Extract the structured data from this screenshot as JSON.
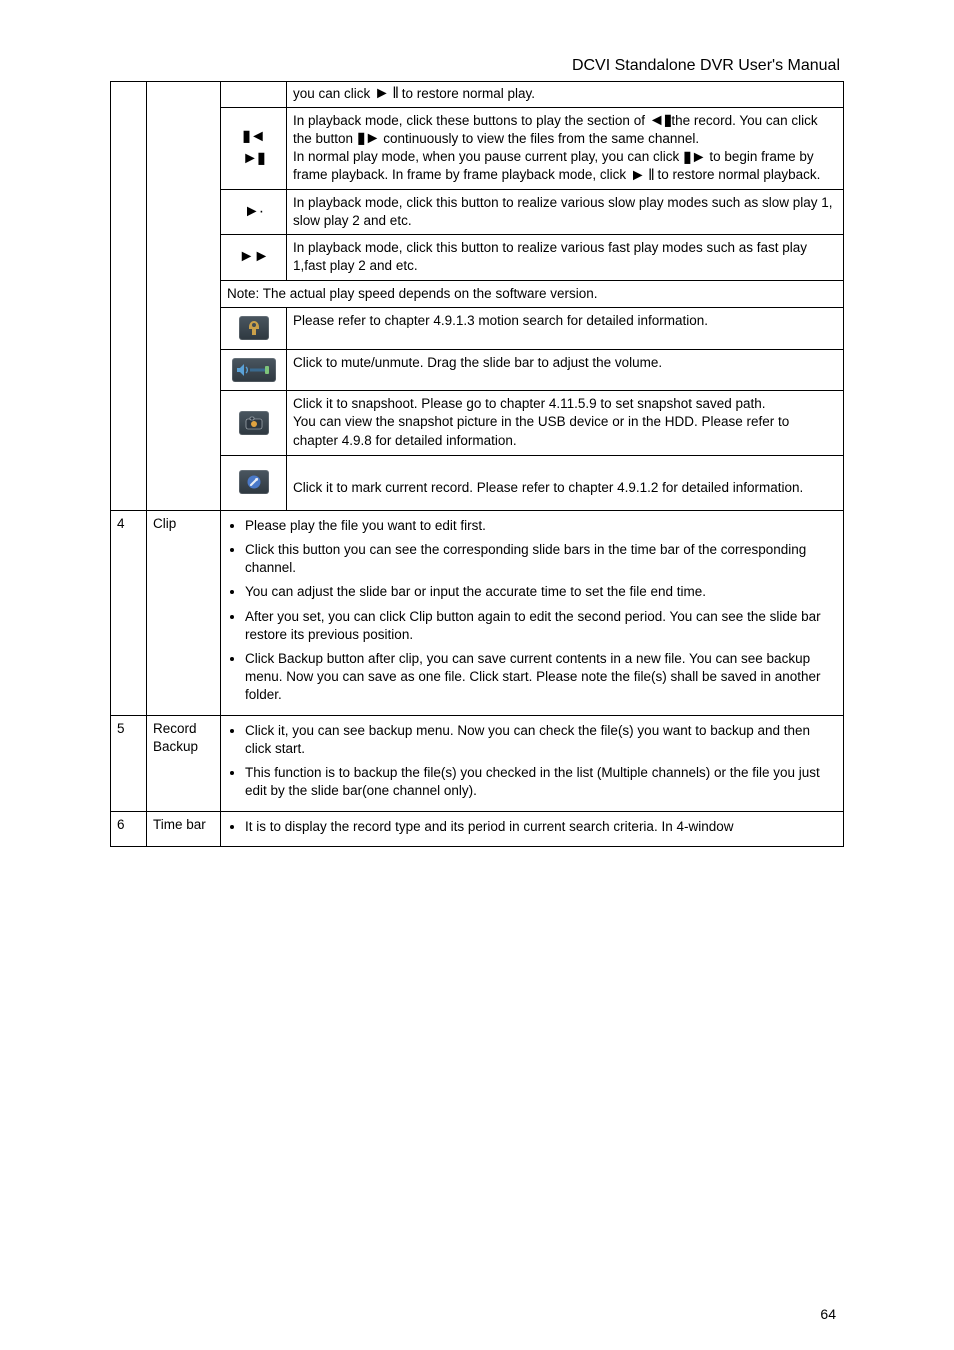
{
  "doc_title": "DCVI Standalone DVR User's Manual",
  "page_number": "64",
  "glyphs": {
    "play_pause": "► ‖",
    "prev_pipe": "▮◄",
    "next_pipe": "►▮",
    "pipe_prev": "◄▮",
    "pipe_next": "▮►",
    "slowplay": "►·",
    "fastfwd": "►►",
    "bullet": "●"
  },
  "icon_sq": {
    "smart": "smart-search-icon",
    "volume": "volume-slider-icon",
    "snapshot": "snapshot-icon",
    "mark": "mark-icon"
  },
  "row_group1": {
    "top_desc_prefix": "you can click ",
    "top_desc_suffix": " to restore normal play.",
    "prevnext": {
      "line1_a": "In playback mode,  click  these  buttons  to  play  the  section  of ",
      "line1_b": "the  record.  You  can  click  the  button ",
      "line1_c": "  continuously  to  view ",
      "line1_d": "the files from the same channel. ",
      "line2_a": "In  normal  play  mode,  when  you  pause  current  play,  you  can ",
      "line2_b": "click ",
      "line2_c": "  to  begin  frame  by  frame  playback. ",
      "line2_d": "In  frame  by  frame playback mode, click ",
      "line2_e": " to restore normal playback."
    },
    "slow": "In playback mode, click this button to realize various slow play modes such as slow play 1, slow play 2 and etc.",
    "fast": "In  playback  mode,  click  this  button  to  realize  various  fast play modes such as fast play 1,fast play 2 and etc.",
    "note": "Note: The actual play speed depends on the software version.",
    "smart": "Please  refer  to  chapter  4.9.1.3  motion  search  for  detailed information.",
    "volume": "Click to mute/unmute. Drag the slide bar to adjust the volume.",
    "snapshot_l1": "Click  it  to  snapshoot.  Please  go  to  chapter  4.11.5.9  to  set snapshot saved path.",
    "snapshot_l2": "You can view the snapshot picture in the USB device or in the HDD. Please refer to chapter 4.9.8 for detailed information.",
    "mark_l1": "",
    "mark": "Click  it  to  mark  current  record.  Please  refer  to  chapter 4.9.1.2 for detailed information."
  },
  "rows": [
    {
      "sn": "4",
      "name": "Clip",
      "bullets": [
        "Please play the file you want to edit first.",
        "Click  this  button  you  can  see  the  corresponding  slide  bars  in  the  time  bar  of  the corresponding channel.",
        "You can adjust the slide bar or input the accurate time to set the file end time.",
        "After  you  set,  you  can  click  Clip  button  again  to  edit  the  second  period.  You  can  see the slide bar restore its previous position.",
        "Click Backup button after clip, you can save current contents in a new file. You can see backup  menu.  Now  you  can  save  as  one  file.  Click  start.  Please  note  the  file(s)  shall  be saved in another folder. "
      ]
    },
    {
      "sn": "5",
      "name": "Record Backup",
      "bullets": [
        "Click it, you can see backup menu. Now you can check the file(s) you want to backup and then click start.",
        "This function is to backup the file(s) you checked in the list (Multiple channels) or the file you just edit by the slide bar(one channel only)."
      ]
    },
    {
      "sn": "6",
      "name": "Time bar",
      "bullets": [
        "It  is  to  display  the  record  type  and  its  period  in  current  search  criteria.  In  4-window"
      ]
    }
  ]
}
